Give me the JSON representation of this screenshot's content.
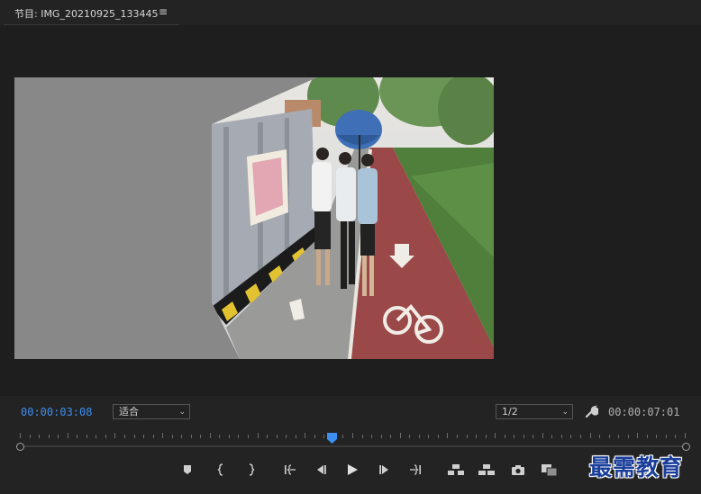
{
  "header": {
    "title": "节目: IMG_20210925_133445",
    "menu_icon": "hamburger-menu-icon",
    "menu_glyph": "≡"
  },
  "preview": {
    "scene": "video-frame-people-walking-umbrella-bike-lane"
  },
  "timebar": {
    "current_time": "00:00:03:08",
    "fit_select": {
      "selected": "适合"
    },
    "resolution_select": {
      "selected": "1/2"
    },
    "settings_icon": "wrench-icon",
    "duration": "00:00:07:01",
    "playhead_fraction": 0.469
  },
  "transport": {
    "buttons": [
      {
        "name": "add-marker-button",
        "icon": "marker-icon"
      },
      {
        "name": "mark-in-button",
        "icon": "mark-in-icon"
      },
      {
        "name": "mark-out-button",
        "icon": "mark-out-icon"
      },
      {
        "name": "go-to-in-button",
        "icon": "go-to-in-icon"
      },
      {
        "name": "step-back-button",
        "icon": "step-back-icon"
      },
      {
        "name": "play-button",
        "icon": "play-icon"
      },
      {
        "name": "step-forward-button",
        "icon": "step-forward-icon"
      },
      {
        "name": "go-to-out-button",
        "icon": "go-to-out-icon"
      },
      {
        "name": "lift-button",
        "icon": "lift-icon"
      },
      {
        "name": "extract-button",
        "icon": "extract-icon"
      },
      {
        "name": "export-frame-button",
        "icon": "camera-icon"
      },
      {
        "name": "comparison-view-button",
        "icon": "comparison-view-icon"
      }
    ]
  },
  "watermark": {
    "text": "最需教育"
  },
  "colors": {
    "panel_bg": "#232323",
    "frame_bg": "#888888",
    "accent_blue": "#3c8ff0",
    "watermark_blue": "#1a3e9a"
  }
}
